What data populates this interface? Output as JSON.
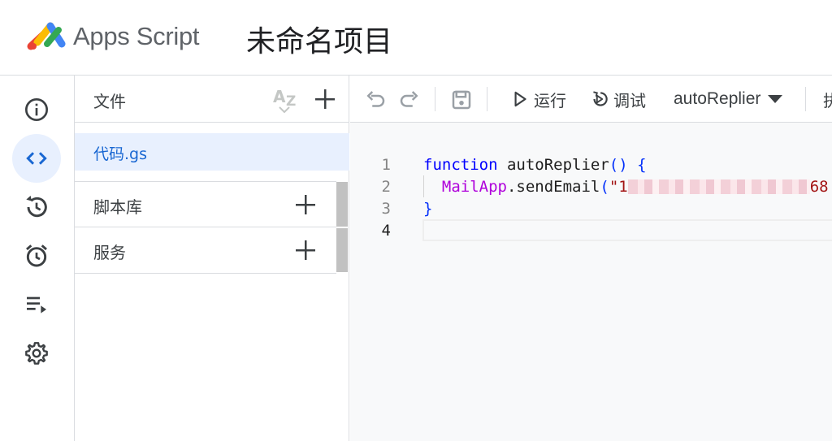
{
  "header": {
    "app_name": "Apps Script",
    "project_title": "未命名项目"
  },
  "rail": {
    "items": [
      {
        "name": "overview",
        "icon": "info-icon"
      },
      {
        "name": "editor",
        "icon": "code-icon",
        "active": true
      },
      {
        "name": "executions",
        "icon": "history-icon"
      },
      {
        "name": "triggers",
        "icon": "alarm-icon"
      },
      {
        "name": "executions-list",
        "icon": "playlist-icon"
      },
      {
        "name": "settings",
        "icon": "gear-icon"
      }
    ]
  },
  "files": {
    "label": "文件",
    "items": [
      {
        "name": "代码.gs",
        "selected": true
      }
    ],
    "libraries_label": "脚本库",
    "services_label": "服务"
  },
  "toolbar": {
    "run_label": "运行",
    "debug_label": "调试",
    "function_name": "autoReplier",
    "overflow_text": "执"
  },
  "code": {
    "lines": [
      {
        "num": "1",
        "text": "function autoReplier() {"
      },
      {
        "num": "2",
        "text": "MailApp.sendEmail(\"1"
      },
      {
        "num": "3",
        "text": "}"
      },
      {
        "num": "4",
        "text": ""
      }
    ],
    "line2_tail": "68",
    "tokens": {
      "kw_function": "function",
      "fn_name": " autoReplier",
      "parens": "()",
      "open_brace": " {",
      "indent": "  ",
      "cls": "MailApp",
      "dot_method": ".sendEmail",
      "open_paren": "(",
      "str_start": "\"1",
      "close_brace": "}"
    }
  },
  "colors": {
    "accent": "#1967d2",
    "active_bg": "#e8f0fe",
    "keyword": "#0000ff",
    "string": "#a31515",
    "class": "#af00db"
  }
}
